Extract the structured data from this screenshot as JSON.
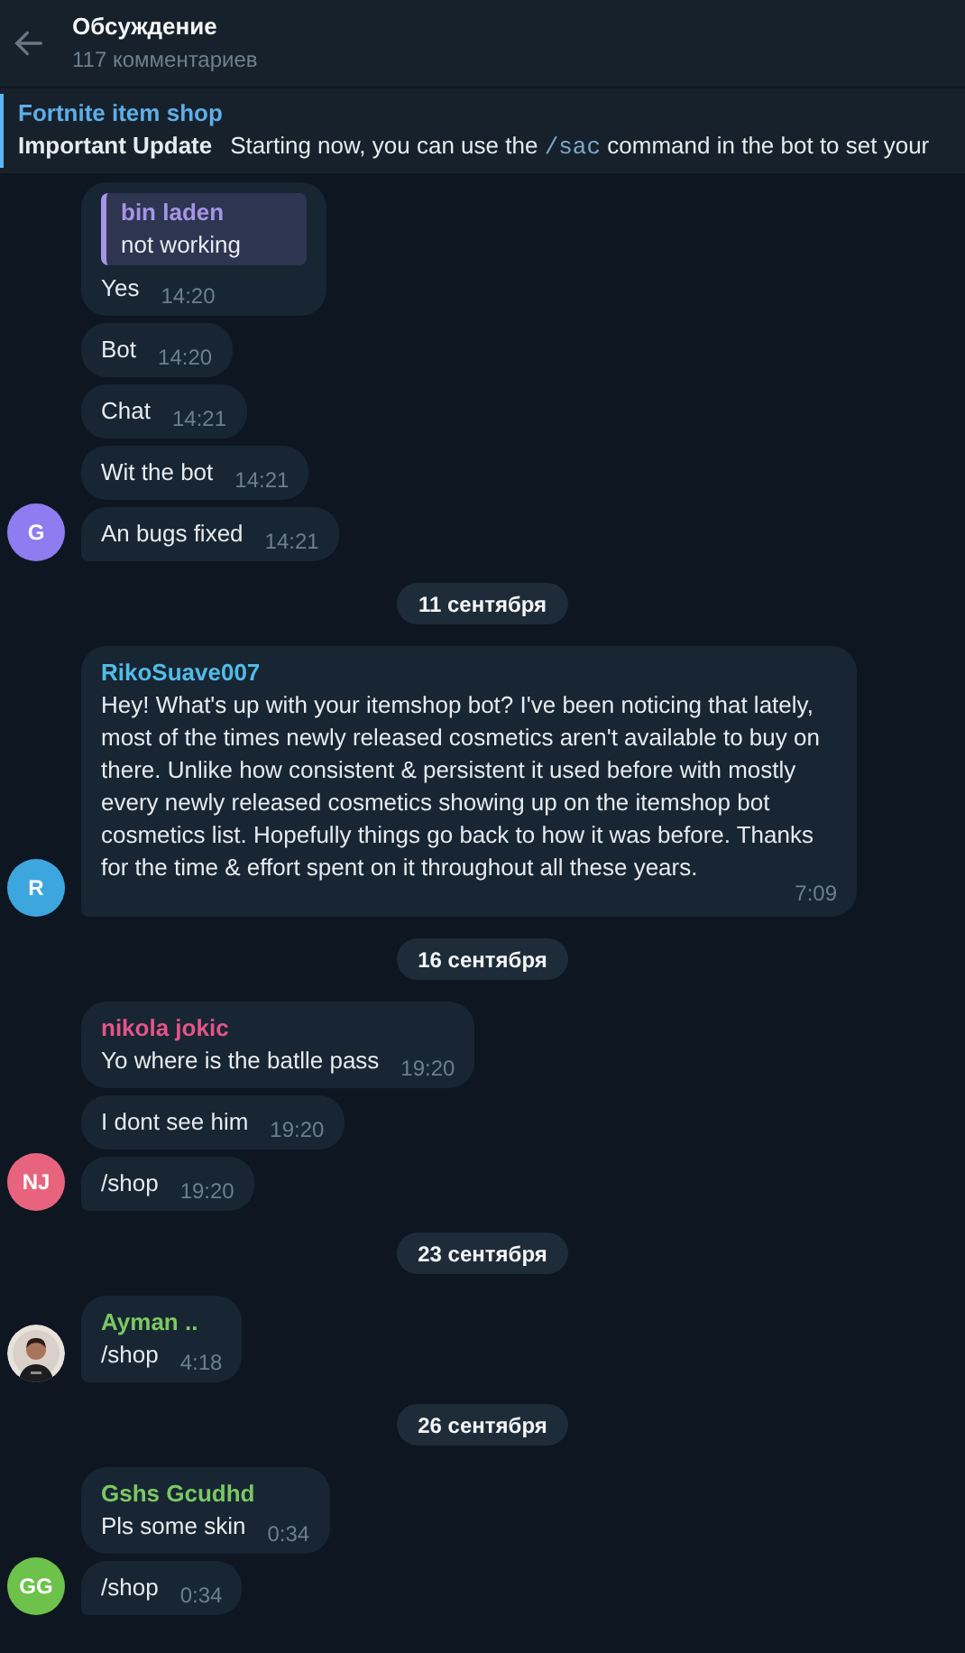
{
  "header": {
    "title": "Обсуждение",
    "subtitle": "117 комментариев"
  },
  "pinned": {
    "title": "Fortnite item shop",
    "label": "Important Update",
    "text_before": "Starting now, you can use the",
    "command": "/sac",
    "text_after": "command in the bot to set your"
  },
  "feed": [
    {
      "kind": "group",
      "avatar": {
        "kind": "initials",
        "initials": "G",
        "color": "#8e7cf0"
      },
      "messages": [
        {
          "reply": {
            "name": "bin laden",
            "text": "not working"
          },
          "text": "Yes",
          "time": "14:20"
        },
        {
          "text": "Bot",
          "time": "14:20"
        },
        {
          "text": "Chat",
          "time": "14:21"
        },
        {
          "text": "Wit the bot",
          "time": "14:21"
        },
        {
          "text": "An bugs fixed",
          "time": "14:21"
        }
      ]
    },
    {
      "kind": "date",
      "text": "11 сентября"
    },
    {
      "kind": "group",
      "avatar": {
        "kind": "initials",
        "initials": "R",
        "color": "#3ea6de"
      },
      "sender": {
        "name": "RikoSuave007",
        "color": "#52bce6"
      },
      "messages": [
        {
          "text": "Hey! What's up with your itemshop bot? I've been noticing that lately, most of the times newly released cosmetics aren't available to buy on there. Unlike how consistent & persistent it used before with mostly every newly released cosmetics showing up on the itemshop bot cosmetics list. Hopefully things go back to how it was before. Thanks for the time & effort spent on it throughout all these years.",
          "time": "7:09",
          "block": true
        }
      ]
    },
    {
      "kind": "date",
      "text": "16 сентября"
    },
    {
      "kind": "group",
      "avatar": {
        "kind": "initials",
        "initials": "NJ",
        "color": "#e8647e"
      },
      "sender": {
        "name": "nikola jokic",
        "color": "#e4558a"
      },
      "messages": [
        {
          "text": "Yo where is the batlle pass",
          "time": "19:20"
        },
        {
          "text": "I dont see him",
          "time": "19:20"
        },
        {
          "text": "/shop",
          "time": "19:20"
        }
      ]
    },
    {
      "kind": "date",
      "text": "23 сентября"
    },
    {
      "kind": "group",
      "avatar": {
        "kind": "picture"
      },
      "sender": {
        "name": "Ayman ..",
        "color": "#7bc862"
      },
      "messages": [
        {
          "text": "/shop",
          "time": "4:18"
        }
      ]
    },
    {
      "kind": "date",
      "text": "26 сентября"
    },
    {
      "kind": "group",
      "avatar": {
        "kind": "initials",
        "initials": "GG",
        "color": "#6cc24a"
      },
      "sender": {
        "name": "Gshs Gcudhd",
        "color": "#7bc862"
      },
      "messages": [
        {
          "text": "Pls some skin",
          "time": "0:34"
        },
        {
          "text": "/shop",
          "time": "0:34"
        }
      ]
    }
  ]
}
